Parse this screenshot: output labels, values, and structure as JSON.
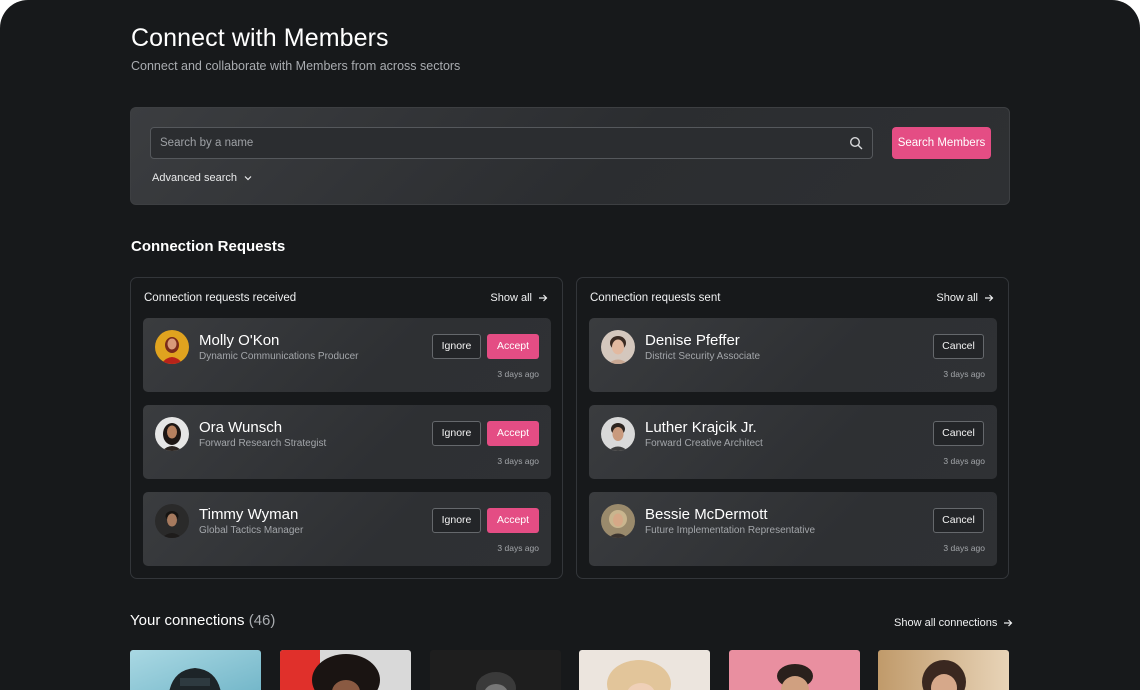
{
  "header": {
    "title": "Connect with Members",
    "subtitle": "Connect and collaborate with Members from across sectors"
  },
  "search": {
    "placeholder": "Search by a name",
    "value": "",
    "button_label": "Search Members",
    "advanced_label": "Advanced search"
  },
  "requests": {
    "section_title": "Connection Requests",
    "received": {
      "title": "Connection requests received",
      "show_all": "Show all",
      "items": [
        {
          "name": "Molly O'Kon",
          "role": "Dynamic Communications Producer",
          "time": "3 days ago",
          "ignore": "Ignore",
          "accept": "Accept"
        },
        {
          "name": "Ora Wunsch",
          "role": "Forward Research Strategist",
          "time": "3 days ago",
          "ignore": "Ignore",
          "accept": "Accept"
        },
        {
          "name": "Timmy Wyman",
          "role": "Global Tactics Manager",
          "time": "3 days ago",
          "ignore": "Ignore",
          "accept": "Accept"
        }
      ]
    },
    "sent": {
      "title": "Connection requests sent",
      "show_all": "Show all",
      "items": [
        {
          "name": "Denise Pfeffer",
          "role": "District Security Associate",
          "time": "3 days ago",
          "cancel": "Cancel"
        },
        {
          "name": "Luther Krajcik Jr.",
          "role": "Forward Creative Architect",
          "time": "3 days ago",
          "cancel": "Cancel"
        },
        {
          "name": "Bessie McDermott",
          "role": "Future Implementation Representative",
          "time": "3 days ago",
          "cancel": "Cancel"
        }
      ]
    }
  },
  "connections": {
    "title": "Your connections",
    "count": "(46)",
    "show_all": "Show all connections"
  },
  "colors": {
    "accent": "#e44d84",
    "background": "#17191b",
    "card": "#2e3033"
  }
}
